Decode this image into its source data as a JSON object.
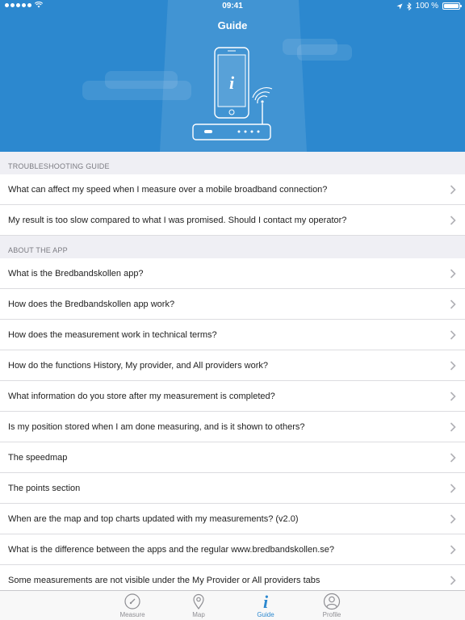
{
  "status_bar": {
    "time": "09:41",
    "battery": "100 %",
    "battery_level": 1.0
  },
  "header": {
    "title": "Guide",
    "illustration_icon": "info-icon",
    "colors": {
      "background": "#2c88cf",
      "accent": "#ffffff"
    }
  },
  "sections": [
    {
      "title": "TROUBLESHOOTING GUIDE",
      "items": [
        {
          "label": "What can affect my speed when I measure over a mobile broadband connection?"
        },
        {
          "label": "My result is too slow compared to what I was promised. Should I contact my operator?"
        }
      ]
    },
    {
      "title": "ABOUT THE APP",
      "items": [
        {
          "label": "What is the Bredbandskollen app?"
        },
        {
          "label": "How does the Bredbandskollen app work?"
        },
        {
          "label": "How does the measurement work in technical terms?"
        },
        {
          "label": "How do the functions History, My provider, and All providers work?"
        },
        {
          "label": "What information do you store after my measurement is completed?"
        },
        {
          "label": "Is my position stored when I am done measuring, and is it shown to others?"
        },
        {
          "label": "The speedmap"
        },
        {
          "label": "The points section"
        },
        {
          "label": "When are the map and top charts updated with my measurements? (v2.0)"
        },
        {
          "label": "What is the difference between the apps and the regular www.bredbandskollen.se?"
        },
        {
          "label": "Some measurements are not visible under the My Provider or All providers tabs"
        }
      ]
    }
  ],
  "tabbar": {
    "active_color": "#2c88cf",
    "inactive_color": "#8e8e93",
    "tabs": [
      {
        "label": "Measure",
        "icon": "speedometer-icon"
      },
      {
        "label": "Map",
        "icon": "map-pin-icon"
      },
      {
        "label": "Guide",
        "icon": "info-icon"
      },
      {
        "label": "Profile",
        "icon": "profile-icon"
      }
    ]
  }
}
